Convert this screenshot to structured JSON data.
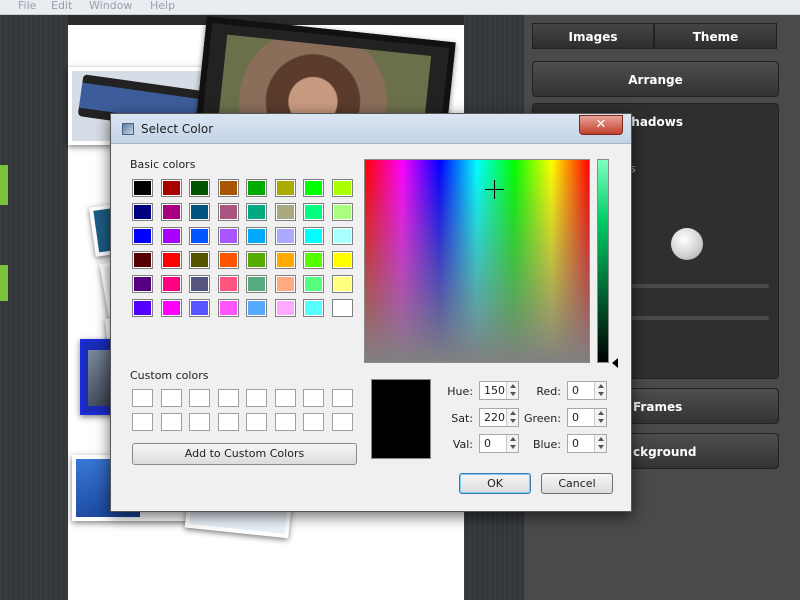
{
  "menubar": {
    "file": "File",
    "edit": "Edit",
    "window": "Window",
    "help": "Help"
  },
  "right_panel": {
    "tabs": [
      "Images",
      "Theme"
    ],
    "arrange": "Arrange",
    "shadows_header": "Shadows",
    "shadows_label1": "ws",
    "shadows_label2": "w",
    "frames": "Frames",
    "background": "ckground"
  },
  "dialog": {
    "title": "Select Color",
    "close": "✕",
    "basic_colors_label": "Basic colors",
    "custom_colors_label": "Custom colors",
    "basic_colors": [
      "#000000",
      "#aa0000",
      "#005500",
      "#aa5500",
      "#00aa00",
      "#aaaa00",
      "#00ff00",
      "#aaff00",
      "#000080",
      "#aa0080",
      "#005580",
      "#aa5580",
      "#00aa80",
      "#aaaa80",
      "#00ff80",
      "#aaff80",
      "#0000ff",
      "#aa00ff",
      "#0055ff",
      "#aa55ff",
      "#00aaff",
      "#aaaaff",
      "#00ffff",
      "#aaffff",
      "#550000",
      "#ff0000",
      "#555500",
      "#ff5500",
      "#55aa00",
      "#ffaa00",
      "#55ff00",
      "#ffff00",
      "#550080",
      "#ff0080",
      "#555580",
      "#ff5580",
      "#55aa80",
      "#ffaa80",
      "#55ff80",
      "#ffff80",
      "#5500ff",
      "#ff00ff",
      "#5555ff",
      "#ff55ff",
      "#55aaff",
      "#ffaaff",
      "#55ffff",
      "#ffffff"
    ],
    "add_custom": "Add to Custom Colors",
    "fields": {
      "hue_label": "Hue:",
      "hue": "150",
      "sat_label": "Sat:",
      "sat": "220",
      "val_label": "Val:",
      "val": "0",
      "red_label": "Red:",
      "red": "0",
      "green_label": "Green:",
      "green": "0",
      "blue_label": "Blue:",
      "blue": "0"
    },
    "ok": "OK",
    "cancel": "Cancel"
  }
}
